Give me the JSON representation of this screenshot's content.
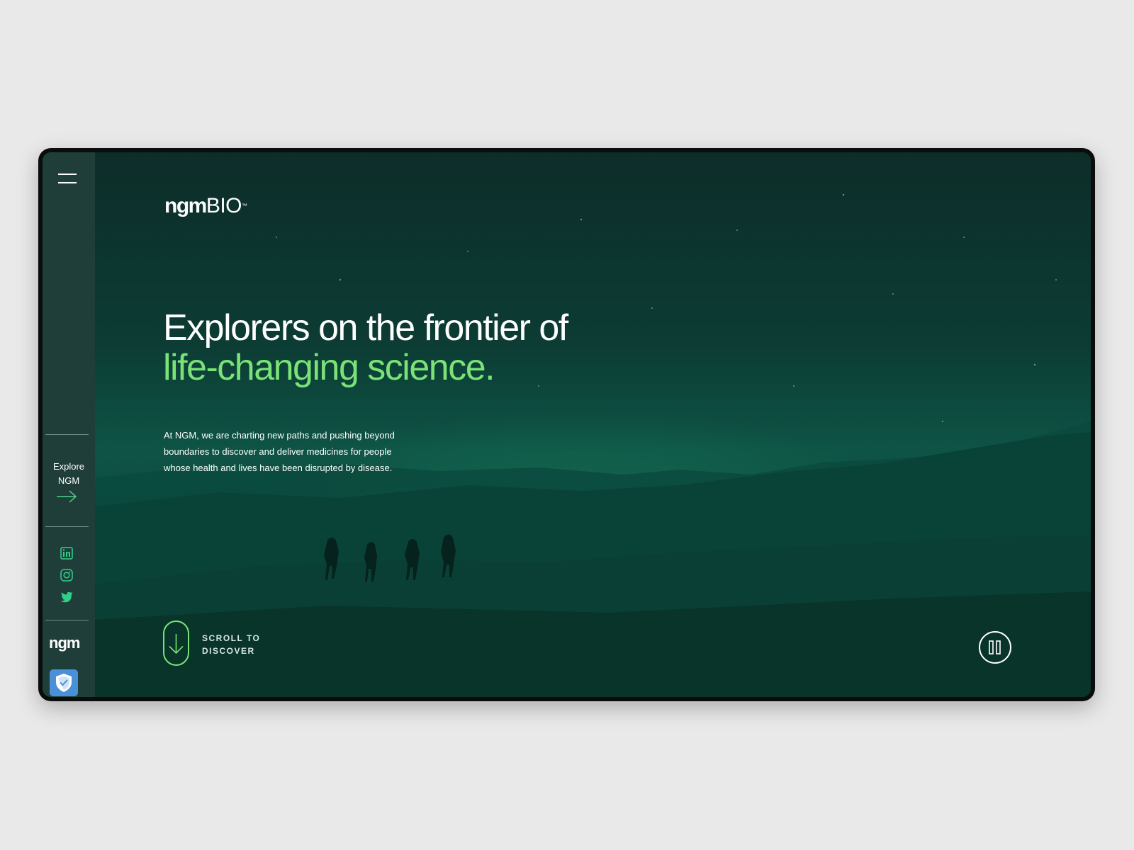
{
  "sidebar": {
    "menu_icon": "hamburger-icon",
    "explore": {
      "line1": "Explore",
      "line2": "NGM",
      "icon": "arrow-right-icon"
    },
    "social": [
      "linkedin-icon",
      "instagram-icon",
      "twitter-icon"
    ],
    "logo_text": "ngm",
    "badge_icon": "shield-check-icon"
  },
  "header": {
    "brand_primary": "ngm",
    "brand_secondary": "BIO",
    "brand_mark": "™"
  },
  "hero": {
    "headline_line1": "Explorers on the frontier of",
    "headline_line2": "life-changing science.",
    "intro": "At NGM, we are charting new paths and pushing beyond boundaries to discover and deliver medicines for people whose health and lives have been disrupted by disease."
  },
  "scroll_cta": {
    "line1": "SCROLL TO",
    "line2": "DISCOVER",
    "icon": "arrow-down-icon"
  },
  "media_control": {
    "icon": "pause-icon"
  },
  "colors": {
    "accent_green": "#7be376",
    "sidebar_bg": "#1f3e39",
    "hero_bg": "#0c3b33",
    "badge_blue": "#4a90d9",
    "page_bg": "#e9e9e9"
  }
}
